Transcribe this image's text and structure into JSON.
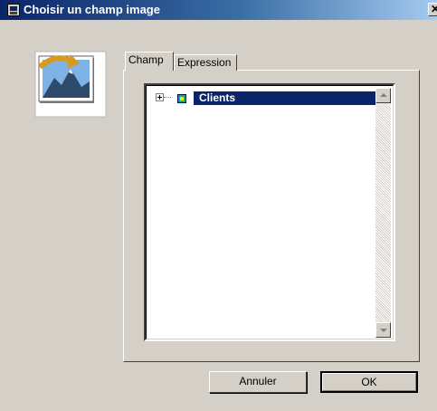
{
  "window": {
    "title": "Choisir un champ image",
    "close_glyph": "✕",
    "icon": "app-window-icon"
  },
  "picture_icon": "picture-import-icon",
  "tabs": [
    {
      "label": "Champ",
      "active": true
    },
    {
      "label": "Expression",
      "active": false
    }
  ],
  "tree": {
    "items": [
      {
        "label": "Clients",
        "icon": "table-icon",
        "expanded": false,
        "selected": true
      }
    ]
  },
  "buttons": {
    "cancel": "Annuler",
    "ok": "OK"
  },
  "colors": {
    "selection": "#0a246a",
    "dialog_bg": "#d4d0c8"
  }
}
